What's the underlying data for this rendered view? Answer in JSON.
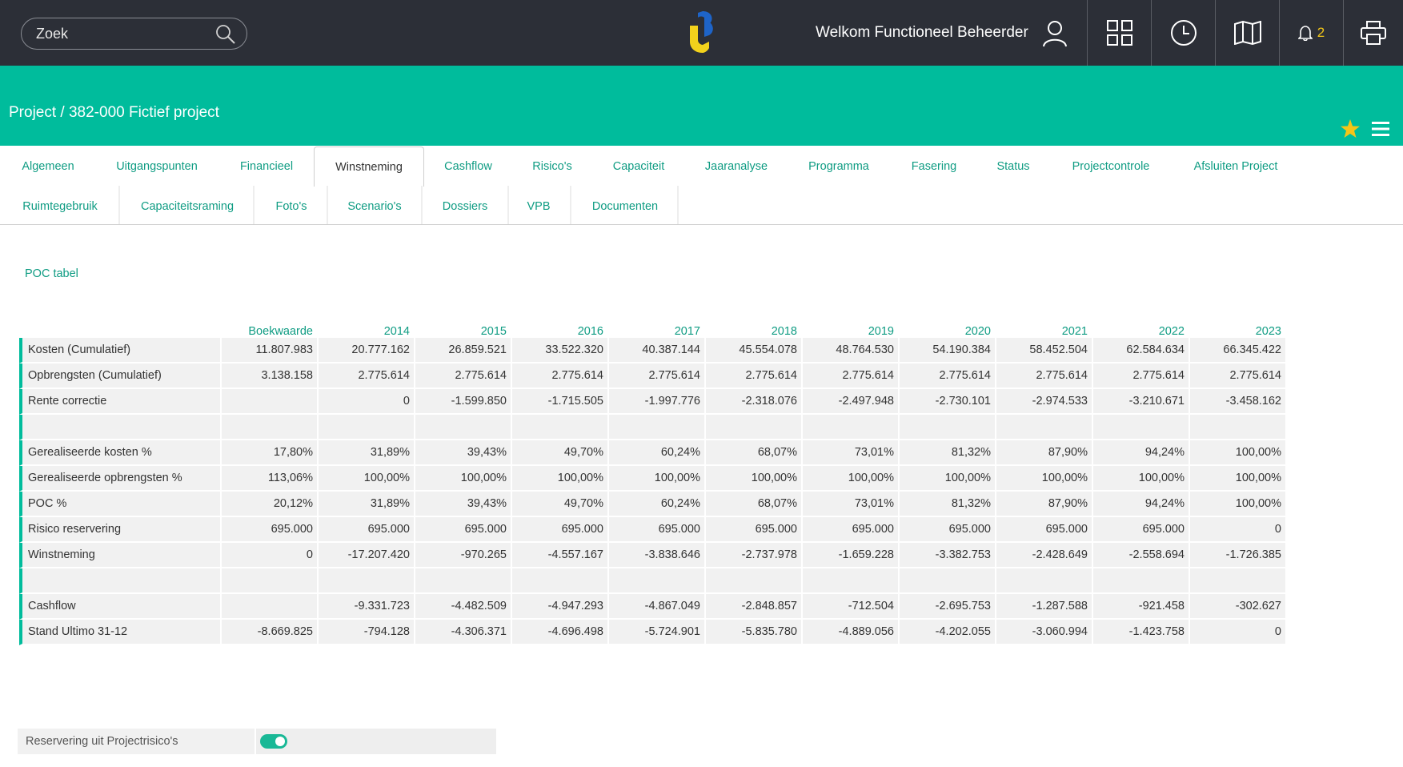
{
  "header": {
    "search_placeholder": "Zoek",
    "welcome_text": "Welkom Functioneel Beheerder",
    "notification_count": "2",
    "icons": [
      "search-icon",
      "app-logo",
      "user-icon",
      "grid-icon",
      "clock-icon",
      "map-icon",
      "bell-icon",
      "printer-icon"
    ]
  },
  "title_band": {
    "breadcrumb": "Project / 382-000 Fictief project",
    "icons": [
      "star-icon",
      "menu-icon"
    ]
  },
  "tabs": [
    {
      "label": "Algemeen"
    },
    {
      "label": "Uitgangspunten"
    },
    {
      "label": "Financieel"
    },
    {
      "label": "Winstneming",
      "active": true
    },
    {
      "label": "Cashflow"
    },
    {
      "label": "Risico's"
    },
    {
      "label": "Capaciteit"
    },
    {
      "label": "Jaaranalyse"
    },
    {
      "label": "Programma"
    },
    {
      "label": "Fasering"
    },
    {
      "label": "Status"
    },
    {
      "label": "Projectcontrole"
    },
    {
      "label": "Afsluiten Project"
    },
    {
      "label": "Ruimtegebruik"
    },
    {
      "label": "Capaciteitsraming"
    },
    {
      "label": "Foto's"
    },
    {
      "label": "Scenario's"
    },
    {
      "label": "Dossiers"
    },
    {
      "label": "VPB"
    },
    {
      "label": "Documenten"
    }
  ],
  "section": {
    "title": "POC tabel",
    "columns": [
      "Boekwaarde",
      "2014",
      "2015",
      "2016",
      "2017",
      "2018",
      "2019",
      "2020",
      "2021",
      "2022",
      "2023"
    ],
    "rows": [
      {
        "label": "Kosten (Cumulatief)",
        "values": [
          "11.807.983",
          "20.777.162",
          "26.859.521",
          "33.522.320",
          "40.387.144",
          "45.554.078",
          "48.764.530",
          "54.190.384",
          "58.452.504",
          "62.584.634",
          "66.345.422"
        ]
      },
      {
        "label": "Opbrengsten (Cumulatief)",
        "values": [
          "3.138.158",
          "2.775.614",
          "2.775.614",
          "2.775.614",
          "2.775.614",
          "2.775.614",
          "2.775.614",
          "2.775.614",
          "2.775.614",
          "2.775.614",
          "2.775.614"
        ]
      },
      {
        "label": "Rente correctie",
        "values": [
          "",
          "0",
          "-1.599.850",
          "-1.715.505",
          "-1.997.776",
          "-2.318.076",
          "-2.497.948",
          "-2.730.101",
          "-2.974.533",
          "-3.210.671",
          "-3.458.162"
        ]
      },
      {
        "label": "",
        "values": [
          "",
          "",
          "",
          "",
          "",
          "",
          "",
          "",
          "",
          "",
          ""
        ]
      },
      {
        "label": "Gerealiseerde kosten %",
        "values": [
          "17,80%",
          "31,89%",
          "39,43%",
          "49,70%",
          "60,24%",
          "68,07%",
          "73,01%",
          "81,32%",
          "87,90%",
          "94,24%",
          "100,00%"
        ]
      },
      {
        "label": "Gerealiseerde opbrengsten %",
        "values": [
          "113,06%",
          "100,00%",
          "100,00%",
          "100,00%",
          "100,00%",
          "100,00%",
          "100,00%",
          "100,00%",
          "100,00%",
          "100,00%",
          "100,00%"
        ]
      },
      {
        "label": "POC %",
        "values": [
          "20,12%",
          "31,89%",
          "39,43%",
          "49,70%",
          "60,24%",
          "68,07%",
          "73,01%",
          "81,32%",
          "87,90%",
          "94,24%",
          "100,00%"
        ]
      },
      {
        "label": "Risico reservering",
        "values": [
          "695.000",
          "695.000",
          "695.000",
          "695.000",
          "695.000",
          "695.000",
          "695.000",
          "695.000",
          "695.000",
          "695.000",
          "0"
        ]
      },
      {
        "label": "Winstneming",
        "values": [
          "0",
          "-17.207.420",
          "-970.265",
          "-4.557.167",
          "-3.838.646",
          "-2.737.978",
          "-1.659.228",
          "-3.382.753",
          "-2.428.649",
          "-2.558.694",
          "-1.726.385"
        ]
      },
      {
        "label": "",
        "values": [
          "",
          "",
          "",
          "",
          "",
          "",
          "",
          "",
          "",
          "",
          ""
        ]
      },
      {
        "label": "Cashflow",
        "values": [
          "",
          "-9.331.723",
          "-4.482.509",
          "-4.947.293",
          "-4.867.049",
          "-2.848.857",
          "-712.504",
          "-2.695.753",
          "-1.287.588",
          "-921.458",
          "-302.627"
        ]
      },
      {
        "label": "Stand Ultimo 31-12",
        "values": [
          "-8.669.825",
          "-794.128",
          "-4.306.371",
          "-4.696.498",
          "-5.724.901",
          "-5.835.780",
          "-4.889.056",
          "-4.202.055",
          "-3.060.994",
          "-1.423.758",
          "0"
        ]
      }
    ]
  },
  "reservation": {
    "label": "Reservering uit Projectrisico's",
    "toggle_on": true
  },
  "colors": {
    "topbar": "#2c2f37",
    "accent": "#00bc9c",
    "link": "#0f9c83",
    "badge": "#f0c419"
  }
}
